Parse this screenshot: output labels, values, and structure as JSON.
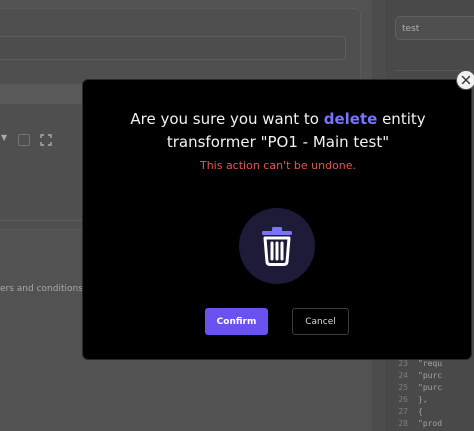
{
  "background": {
    "terms_text": "ers and conditions",
    "right_panel_input_value": "test",
    "code_lines": [
      {
        "line": "23",
        "text": "\"requ"
      },
      {
        "line": "24",
        "text": "\"purc"
      },
      {
        "line": "25",
        "text": "\"purc"
      },
      {
        "line": "26",
        "text": "},"
      },
      {
        "line": "27",
        "text": "{"
      },
      {
        "line": "28",
        "text": "\"prod"
      }
    ]
  },
  "modal": {
    "title_prefix": "Are you sure you want to ",
    "title_highlight": "delete",
    "title_suffix_line1": " entity",
    "title_line2": "transformer \"PO1 - Main test\"",
    "warning": "This action can't be undone.",
    "confirm_label": "Confirm",
    "cancel_label": "Cancel",
    "icons": {
      "trash": "trash-icon",
      "close": "close-icon"
    },
    "colors": {
      "accent": "#6a52f0",
      "highlight": "#7a73ff",
      "warning": "#e0584b"
    }
  }
}
